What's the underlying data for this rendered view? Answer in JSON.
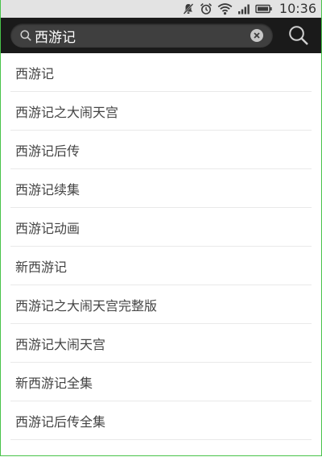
{
  "status_bar": {
    "time": "10:36",
    "icons": [
      "notifications-muted-icon",
      "alarm-icon",
      "wifi-icon",
      "signal-icon",
      "battery-icon"
    ]
  },
  "search": {
    "query": "西游记",
    "search_icon": "search-icon",
    "clear_icon": "clear-icon",
    "submit_icon": "search-icon"
  },
  "suggestions": [
    "西游记",
    "西游记之大闹天宫",
    "西游记后传",
    "西游记续集",
    "西游记动画",
    "新西游记",
    "西游记之大闹天宫完整版",
    "西游记大闹天宫",
    "新西游记全集",
    "西游记后传全集"
  ],
  "colors": {
    "status_bar_bg": "#e3e3e3",
    "search_bar_bg": "#1a1a1a",
    "search_field_bg": "#3f3f3f",
    "frame_border": "#49c34a",
    "divider": "#e9e9e9",
    "item_text": "#444444"
  }
}
